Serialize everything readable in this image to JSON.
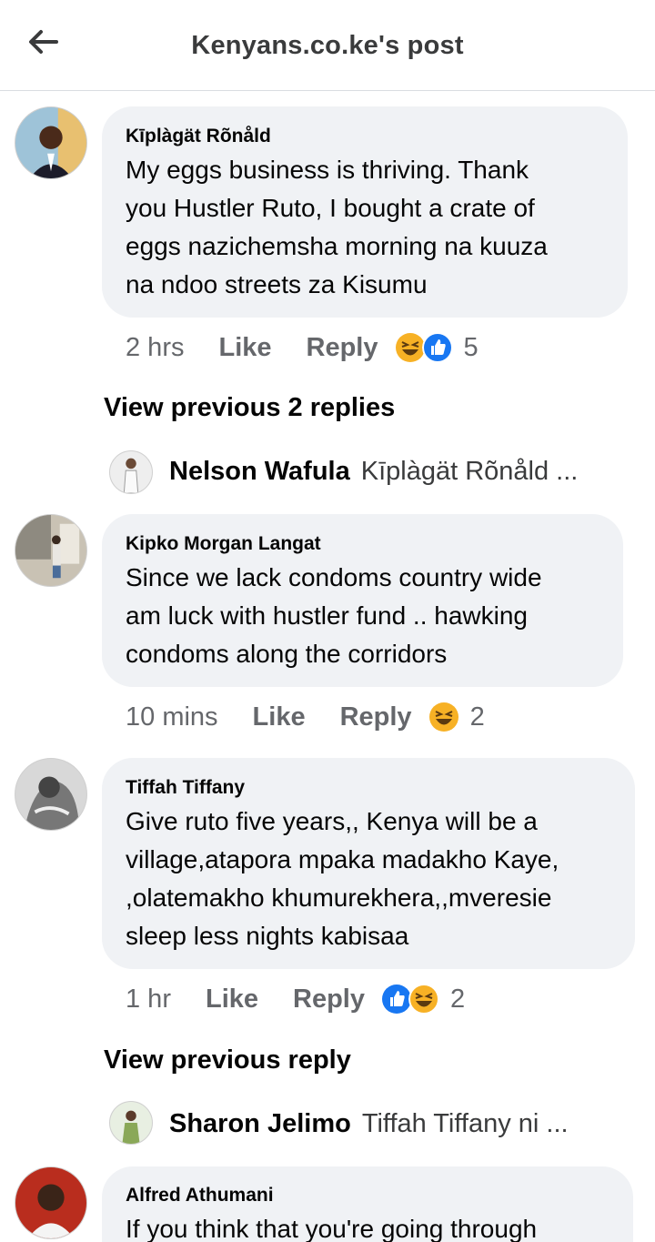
{
  "header": {
    "title": "Kenyans.co.ke's post"
  },
  "comments": [
    {
      "author": "Kīplàgät Rõnåld",
      "lines": [
        "My eggs business is thriving. Thank",
        "you Hustler Ruto, I bought a crate of",
        "eggs nazichemsha morning na kuuza",
        "na ndoo streets za Kisumu"
      ],
      "time": "2 hrs",
      "like": "Like",
      "reply": "Reply",
      "reactions": [
        "haha-emoji",
        "like-emoji"
      ],
      "count": "5"
    },
    {
      "author": "Kipko Morgan Langat",
      "lines": [
        "Since we lack condoms country wide",
        "am luck with hustler fund .. hawking",
        "condoms along the corridors"
      ],
      "time": "10 mins",
      "like": "Like",
      "reply": "Reply",
      "reactions": [
        "haha-emoji"
      ],
      "count": "2"
    },
    {
      "author": "Tiffah Tiffany",
      "lines": [
        "Give ruto five years,, Kenya will be a",
        "village,atapora mpaka madakho Kaye,",
        ",olatemakho khumurekhera,,mveresie",
        "sleep less nights kabisaa"
      ],
      "time": "1 hr",
      "like": "Like",
      "reply": "Reply",
      "reactions": [
        "like-emoji",
        "haha-emoji"
      ],
      "count": "2"
    },
    {
      "author": "Alfred Athumani",
      "lines": [
        "If you think that you're going through"
      ]
    }
  ],
  "view_previous": [
    "View previous 2 replies",
    "View previous reply"
  ],
  "replies": [
    {
      "name": "Nelson Wafula",
      "text": "Kīplàgät Rõnåld ..."
    },
    {
      "name": "Sharon Jelimo",
      "text": "Tiffah Tiffany ni ..."
    }
  ],
  "colors": {
    "bubble": "#f0f2f5",
    "muted": "#65676b",
    "like_blue": "#1877f2",
    "haha_yellow": "#f7b125"
  }
}
